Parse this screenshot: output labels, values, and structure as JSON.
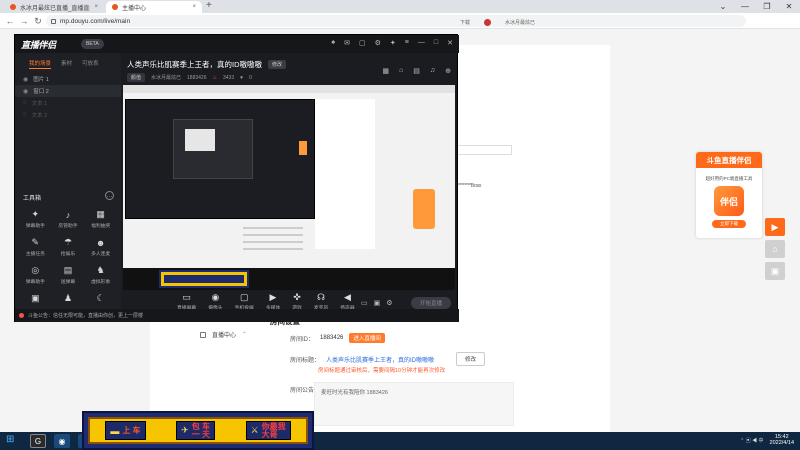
{
  "browser": {
    "tabs": [
      {
        "label": "水冰月最炫已直播_直播直播_斗...",
        "close": "×"
      },
      {
        "label": "主播中心",
        "close": "×"
      }
    ],
    "new_tab": "+",
    "window_controls": [
      "⌄",
      "—",
      "❐",
      "✕"
    ],
    "url": "mp.douyu.com/live/main"
  },
  "site": {
    "header_items": [
      "下载",
      "水冰月最炫已"
    ],
    "section_title": "房间设置",
    "sidebar_item": "直播中心",
    "fields": {
      "room_id_label": "房间ID：",
      "room_id_value": "1883426",
      "room_id_tag": "进入直播间",
      "room_title_label": "房间标题：",
      "room_title_value": "人类声乐比肌赛季上王者，真的ID嗷嗷嗷",
      "edit_button": "修改",
      "title_warning": "房间标题通过审核后，需要间隔10分钟才能再次修改",
      "notice_label": "房间公告：",
      "notice_value": "麦旺时光有我陪你 1883426"
    },
    "stars_text": "*********Boss"
  },
  "promo": {
    "header": "斗鱼直播伴侣",
    "sub": "超好用的PC端直播工具",
    "logo_text": "伴侣",
    "download": "立即下载"
  },
  "app": {
    "logo": "直播伴侣",
    "version": "BETA",
    "left_tabs": [
      "我的场景",
      "素材",
      "可放表"
    ],
    "scenes": [
      {
        "name": "图片 1",
        "state": "normal"
      },
      {
        "name": "窗口 2",
        "state": "selected"
      },
      {
        "name": "文本 1",
        "state": "dim"
      },
      {
        "name": "文本 2",
        "state": "dim"
      }
    ],
    "toolbox_label": "工具箱",
    "tools": [
      {
        "icon": "✦",
        "label": "弹幕助手"
      },
      {
        "icon": "♪",
        "label": "房管助手"
      },
      {
        "icon": "▦",
        "label": "福利抽奖"
      },
      {
        "icon": "✎",
        "label": "主播任务"
      },
      {
        "icon": "☂",
        "label": "抢娱乐"
      },
      {
        "icon": "☻",
        "label": "多人连麦"
      },
      {
        "icon": "◎",
        "label": "弹幕助手"
      },
      {
        "icon": "▤",
        "label": "送弹幕"
      },
      {
        "icon": "♞",
        "label": "虚拟形象"
      },
      {
        "icon": "▣",
        "label": "..."
      },
      {
        "icon": "♟",
        "label": "..."
      },
      {
        "icon": "☾",
        "label": "..."
      }
    ],
    "room_title": "人类声乐比肌赛季上王者，真的ID嗷嗷嗷",
    "room_title_edit": "修改",
    "room_meta": {
      "category": "颜值",
      "name": "水冰月最炫已",
      "room_id": "1883426",
      "hot": "3433",
      "fans": "0"
    },
    "controls": [
      {
        "icon": "▭",
        "label": "直播屏幕"
      },
      {
        "icon": "◉",
        "label": "摄像头"
      },
      {
        "icon": "▢",
        "label": "手机投屏"
      },
      {
        "icon": "▶",
        "label": "多媒体"
      },
      {
        "icon": "✜",
        "label": "游戏"
      },
      {
        "icon": "☊",
        "label": "麦克风"
      },
      {
        "icon": "◀",
        "label": "扬声器"
      }
    ],
    "start_button": "开始直播",
    "status_text": "斗鱼公告：信任无限可能，直播由你创，更上一层楼"
  },
  "overlay_banner": {
    "items": [
      {
        "icon": "▬",
        "text": "上 车",
        "style": "orange"
      },
      {
        "icon": "✈",
        "text": "包 车\n一 天",
        "style": "red"
      },
      {
        "icon": "⚔",
        "text": "你最我\n大哥",
        "style": "red"
      }
    ]
  },
  "taskbar": {
    "clock_time": "15:42",
    "clock_date": "2022/4/14"
  }
}
